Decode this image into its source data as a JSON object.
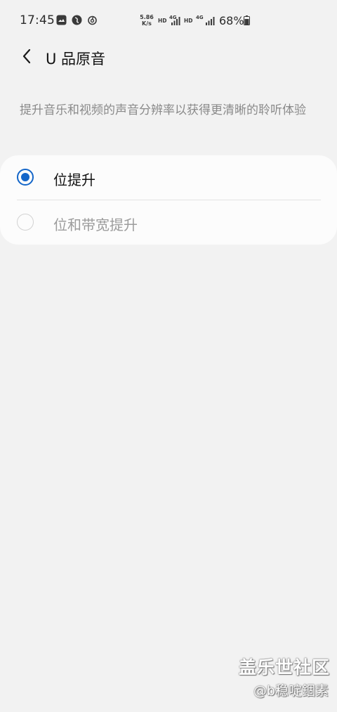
{
  "status_bar": {
    "time": "17:45",
    "net_speed_value": "5.86",
    "net_speed_unit": "K/s",
    "hd_1": "HD",
    "net_type_1": "4G",
    "hd_2": "HD",
    "net_type_2": "4G",
    "battery_percent": "68%",
    "icons": [
      "gallery-icon",
      "app-icon",
      "netease-music-icon",
      "signal-icon",
      "signal-icon",
      "battery-icon"
    ]
  },
  "header": {
    "back_icon": "chevron-left-icon",
    "title": "U 品原音"
  },
  "description": "提升音乐和视频的声音分辨率以获得更清晰的聆听体验",
  "options": [
    {
      "label": "位提升",
      "selected": true,
      "enabled": true
    },
    {
      "label": "位和带宽提升",
      "selected": false,
      "enabled": false
    }
  ],
  "watermark": {
    "title": "盖乐世社区",
    "user": "@b稳啶錮素"
  },
  "colors": {
    "background": "#f2f2f2",
    "card": "#fcfcfc",
    "accent": "#1466c9",
    "secondary_text": "#8a8a8a",
    "disabled_text": "#9c9c9c"
  }
}
